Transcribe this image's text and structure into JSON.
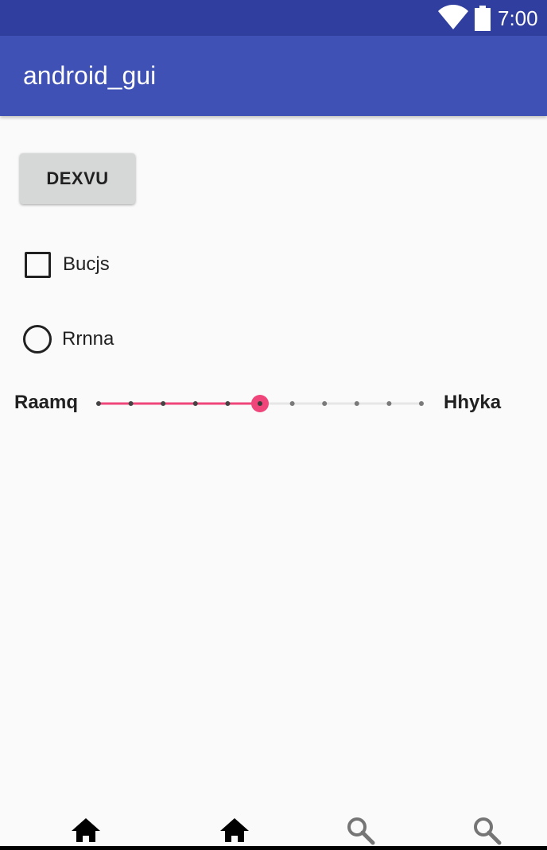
{
  "status_bar": {
    "time": "7:00",
    "icons": [
      "wifi-icon",
      "battery-icon"
    ],
    "background": "#303f9f"
  },
  "app_bar": {
    "title": "android_gui",
    "background": "#3f51b5"
  },
  "main": {
    "button_label": "DEXVU",
    "checkbox": {
      "label": "Bucjs",
      "checked": false
    },
    "radio": {
      "label": "Rrnna",
      "selected": false
    },
    "slider": {
      "min_label": "Raamq",
      "max_label": "Hhyka",
      "value_step": 5,
      "step_count": 10,
      "accent": "#f0457a"
    }
  },
  "bottom_nav": {
    "items": [
      {
        "icon": "home-icon",
        "active": true
      },
      {
        "icon": "home-icon",
        "active": true
      },
      {
        "icon": "search-icon",
        "active": false
      },
      {
        "icon": "search-icon",
        "active": false
      }
    ],
    "active_color": "#000000",
    "inactive_color": "#757575"
  }
}
